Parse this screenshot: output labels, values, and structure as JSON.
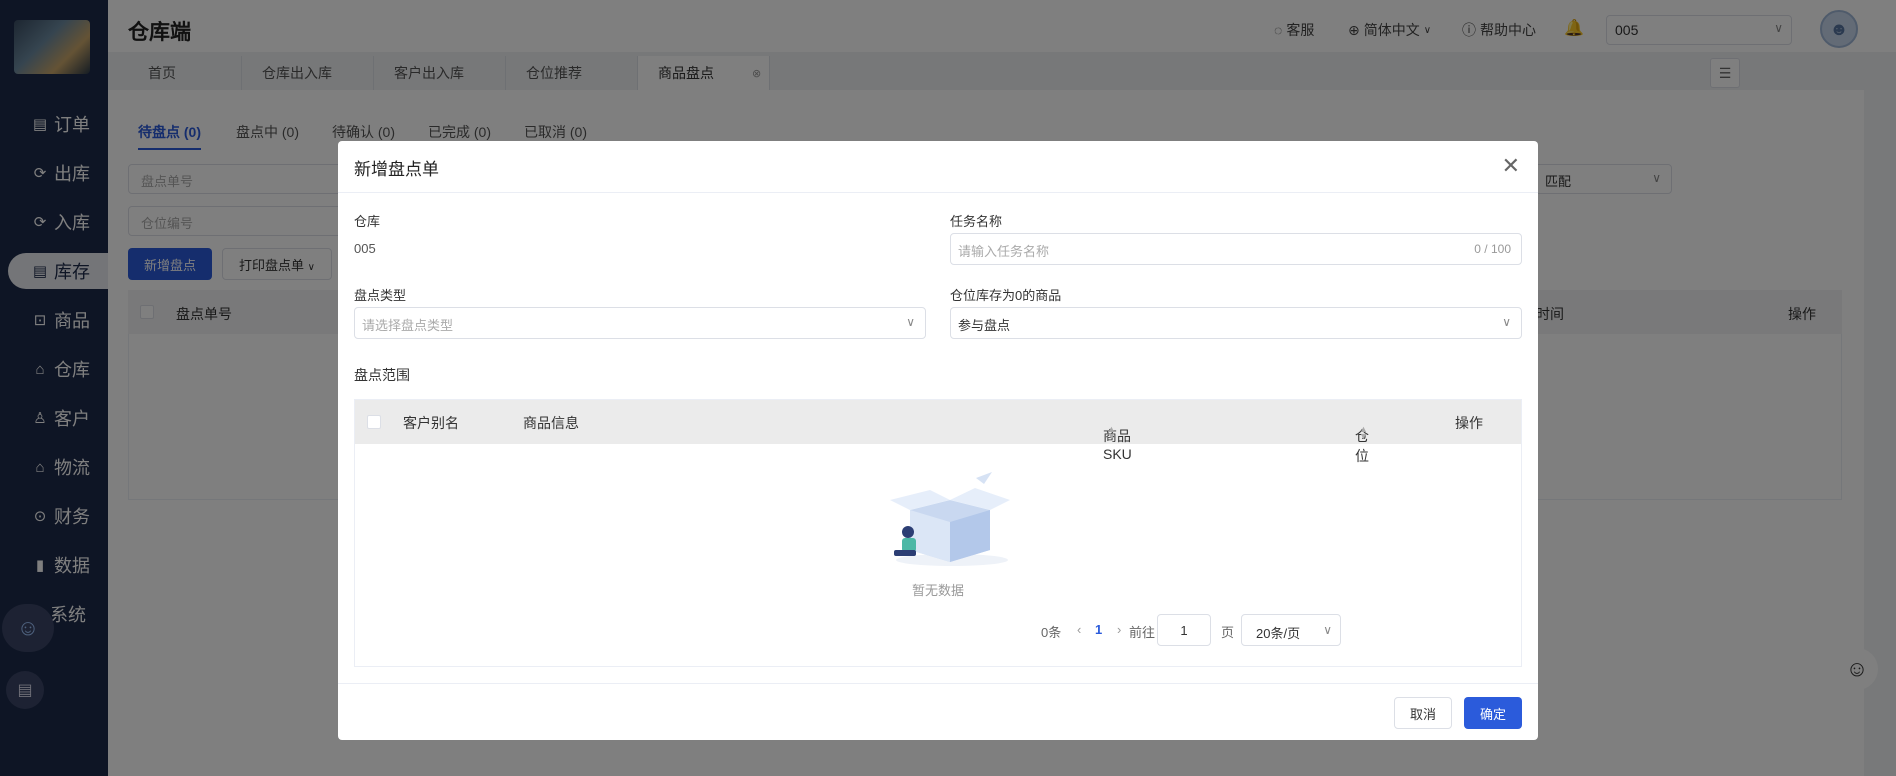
{
  "app": {
    "title": "仓库端"
  },
  "sidebar": {
    "items": [
      {
        "label": "订单",
        "icon": "▤"
      },
      {
        "label": "出库",
        "icon": "⟳"
      },
      {
        "label": "入库",
        "icon": "⟳"
      },
      {
        "label": "库存",
        "icon": "▤"
      },
      {
        "label": "商品",
        "icon": "⊡"
      },
      {
        "label": "仓库",
        "icon": "⌂"
      },
      {
        "label": "客户",
        "icon": "♙"
      },
      {
        "label": "物流",
        "icon": "⌂"
      },
      {
        "label": "财务",
        "icon": "⊙"
      },
      {
        "label": "数据",
        "icon": "▮"
      },
      {
        "label": "系统",
        "icon": ""
      }
    ]
  },
  "header": {
    "service": "客服",
    "language": "简体中文",
    "help": "帮助中心",
    "warehouse": "005"
  },
  "tabs": [
    "首页",
    "仓库出入库",
    "客户出入库",
    "仓位推荐",
    "商品盘点"
  ],
  "subtabs": [
    "待盘点 (0)",
    "盘点中 (0)",
    "待确认 (0)",
    "已完成 (0)",
    "已取消 (0)"
  ],
  "filters": {
    "order_no": "盘点单号",
    "location_no": "仓位编号",
    "match": "匹配"
  },
  "toolbar": {
    "add": "新增盘点",
    "print": "打印盘点单"
  },
  "list_table": {
    "col_order": "盘点单号",
    "col_time": "时间",
    "col_action": "操作"
  },
  "modal": {
    "title": "新增盘点单",
    "warehouse_label": "仓库",
    "warehouse_value": "005",
    "task_name_label": "任务名称",
    "task_name_placeholder": "请输入任务名称",
    "task_name_count": "0 / 100",
    "type_label": "盘点类型",
    "type_placeholder": "请选择盘点类型",
    "zero_stock_label": "仓位库存为0的商品",
    "zero_stock_value": "参与盘点",
    "range_label": "盘点范围",
    "table": {
      "col_alias": "客户别名",
      "col_info": "商品信息",
      "col_sku": "商品SKU",
      "col_location": "仓位",
      "col_action": "操作",
      "empty": "暂无数据"
    },
    "pagination": {
      "total": "0条",
      "current_page": "1",
      "goto_label": "前往",
      "goto_value": "1",
      "page_unit": "页",
      "page_size": "20条/页"
    },
    "cancel": "取消",
    "confirm": "确定"
  },
  "colors": {
    "primary": "#2b5bdb",
    "sidebar": "#1d2a4a"
  }
}
